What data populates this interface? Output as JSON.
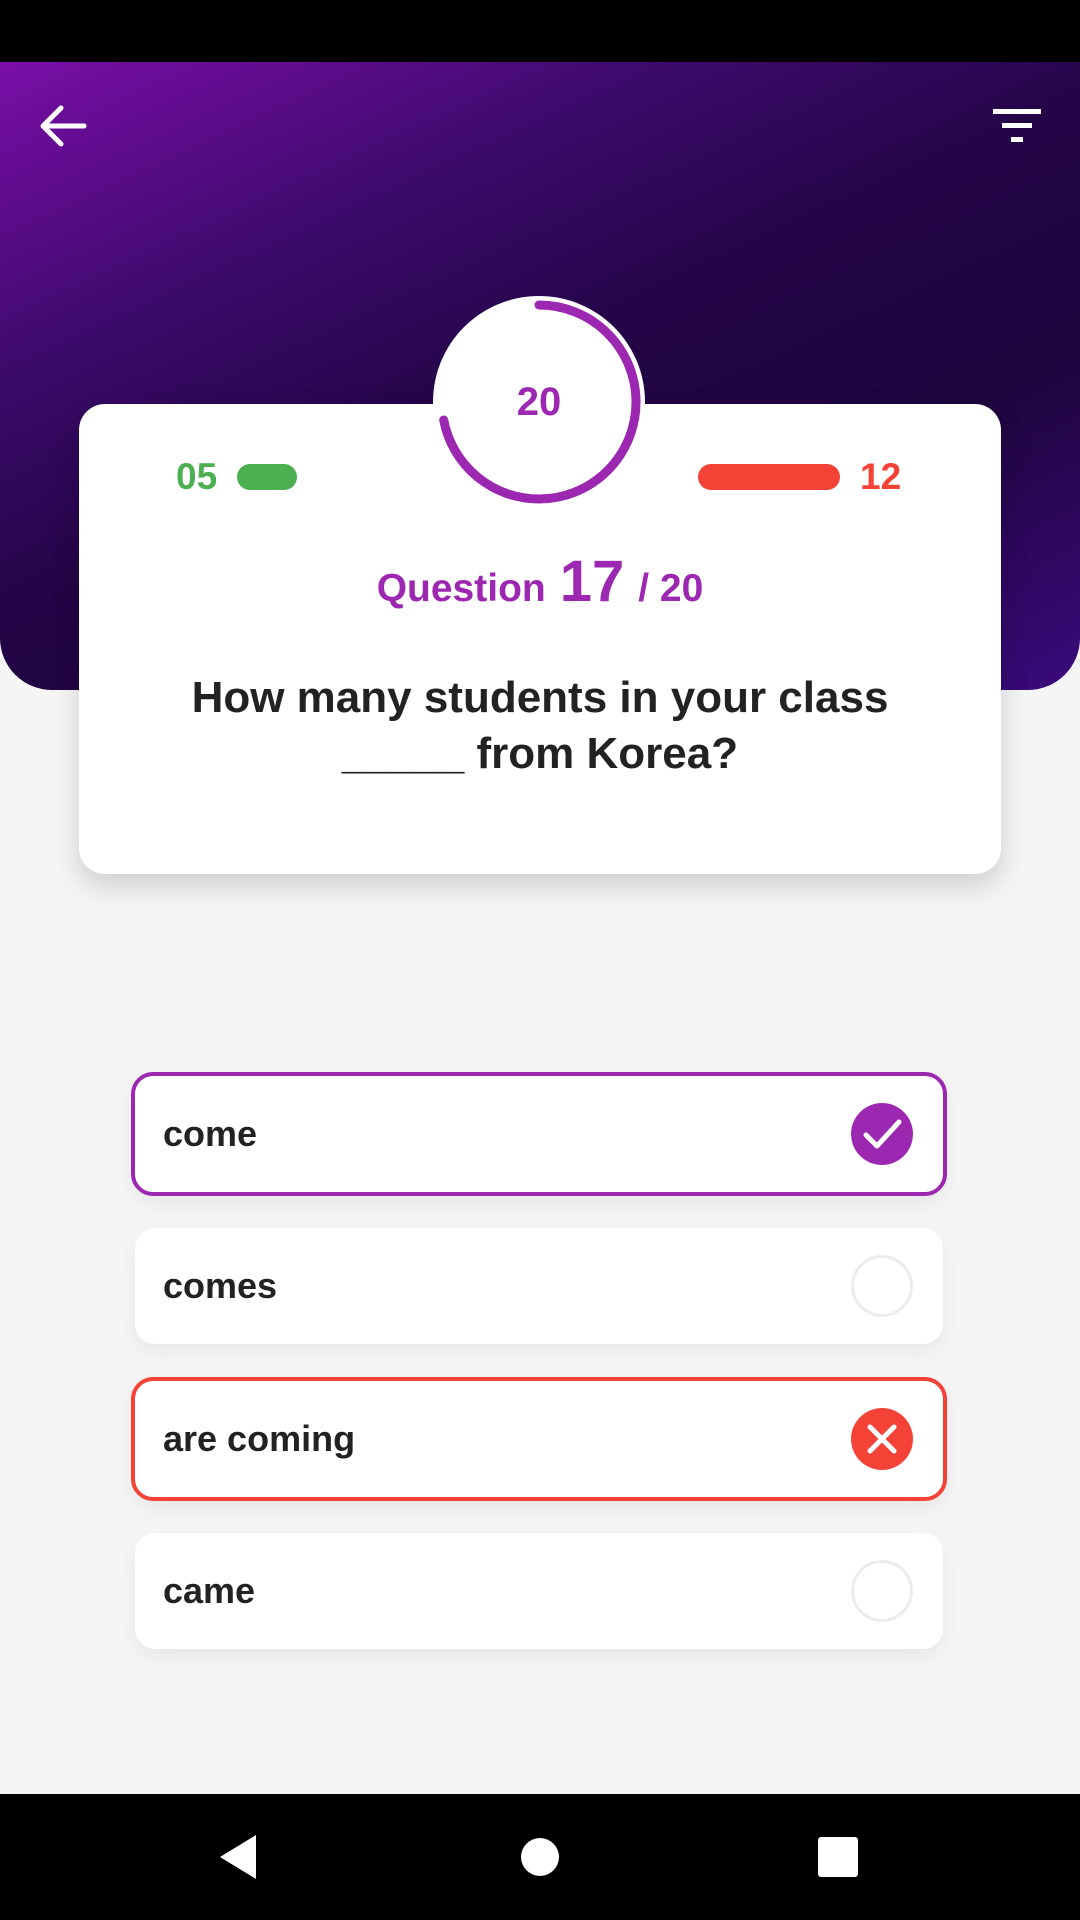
{
  "header": {
    "back_icon": "arrow-left-icon",
    "filter_icon": "filter-icon"
  },
  "timer": {
    "value": "20",
    "progress_fraction": 0.72,
    "color": "#9c27b0"
  },
  "score": {
    "correct": "05",
    "wrong": "12",
    "correct_color": "#4caf50",
    "wrong_color": "#f44336"
  },
  "question": {
    "label": "Question",
    "number": "17",
    "total": "/ 20",
    "text_line1": "How many students in your class",
    "text_line2": "_____ from Korea?"
  },
  "options": [
    {
      "label": "come",
      "state": "selected",
      "icon": "check-circle-icon"
    },
    {
      "label": "comes",
      "state": "empty",
      "icon": "empty-circle-icon"
    },
    {
      "label": "are coming",
      "state": "wrong",
      "icon": "x-circle-icon"
    },
    {
      "label": "came",
      "state": "empty",
      "icon": "empty-circle-icon"
    }
  ],
  "nav": {
    "back_icon": "nav-back-icon",
    "home_icon": "nav-home-icon",
    "recents_icon": "nav-recents-icon"
  }
}
